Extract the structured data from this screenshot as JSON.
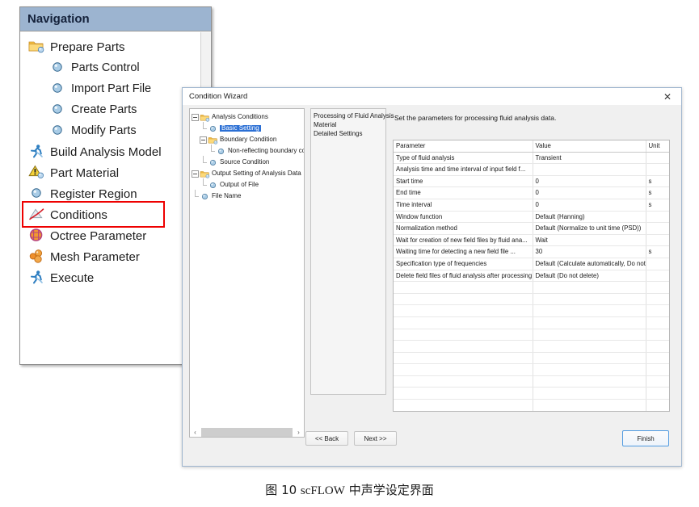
{
  "navigation": {
    "header": "Navigation",
    "items": [
      {
        "label": "Prepare Parts",
        "icon": "folder-icon",
        "level": 1
      },
      {
        "label": "Parts Control",
        "icon": "sphere-node-icon",
        "level": 2
      },
      {
        "label": "Import Part File",
        "icon": "sphere-node-icon",
        "level": 2
      },
      {
        "label": "Create Parts",
        "icon": "sphere-node-icon",
        "level": 2
      },
      {
        "label": "Modify Parts",
        "icon": "sphere-node-icon",
        "level": 2
      },
      {
        "label": "Build Analysis Model",
        "icon": "runner-icon",
        "level": 1
      },
      {
        "label": "Part Material",
        "icon": "warning-triangle-icon",
        "level": 1
      },
      {
        "label": "Register Region",
        "icon": "sphere-node-icon",
        "level": 1
      },
      {
        "label": "Conditions",
        "icon": "conditions-icon",
        "level": 1
      },
      {
        "label": "Octree Parameter",
        "icon": "octree-icon",
        "level": 1
      },
      {
        "label": "Mesh Parameter",
        "icon": "mesh-spheres-icon",
        "level": 1
      },
      {
        "label": "Execute",
        "icon": "runner-icon",
        "level": 1
      }
    ],
    "highlight_color": "#ee0000",
    "highlighted_item": "Conditions"
  },
  "dialog": {
    "title": "Condition Wizard",
    "close_glyph": "✕",
    "tree": [
      {
        "label": "Analysis Conditions",
        "level": 0,
        "icon": "folder-icon",
        "expander": true,
        "selected": false
      },
      {
        "label": "Basic Setting",
        "level": 1,
        "icon": "sphere-node-icon",
        "expander": false,
        "selected": true
      },
      {
        "label": "Boundary Condition",
        "level": 1,
        "icon": "folder-icon",
        "expander": true,
        "selected": false
      },
      {
        "label": "Non-reflecting boundary co",
        "level": 2,
        "icon": "sphere-node-icon",
        "expander": false,
        "selected": false
      },
      {
        "label": "Source Condition",
        "level": 1,
        "icon": "sphere-node-icon",
        "expander": false,
        "selected": false
      },
      {
        "label": "Output Setting of Analysis Data",
        "level": 0,
        "icon": "folder-icon",
        "expander": true,
        "selected": false
      },
      {
        "label": "Output of File",
        "level": 1,
        "icon": "sphere-node-icon",
        "expander": false,
        "selected": false
      },
      {
        "label": "File Name",
        "level": 0,
        "icon": "sphere-node-icon",
        "expander": false,
        "selected": false
      }
    ],
    "mid_list": [
      "Processing of Fluid Analysis",
      "Material",
      "Detailed Settings"
    ],
    "description": "Set the parameters for processing fluid analysis data.",
    "table": {
      "columns": [
        "Parameter",
        "Value",
        "Unit"
      ],
      "rows": [
        {
          "indent": 0,
          "parameter": "Type of fluid analysis",
          "value": "Transient",
          "unit": ""
        },
        {
          "indent": 1,
          "parameter": "Analysis time and time interval of input field f...",
          "value": "",
          "unit": ""
        },
        {
          "indent": 2,
          "parameter": "Start time",
          "value": "0",
          "unit": "s"
        },
        {
          "indent": 2,
          "parameter": "End time",
          "value": "0",
          "unit": "s"
        },
        {
          "indent": 2,
          "parameter": "Time interval",
          "value": "0",
          "unit": "s"
        },
        {
          "indent": 1,
          "parameter": "Window function",
          "value": "Default (Hanning)",
          "unit": ""
        },
        {
          "indent": 1,
          "parameter": "Normalization method",
          "value": "Default (Normalize to unit time (PSD))",
          "unit": ""
        },
        {
          "indent": 1,
          "parameter": "Wait for creation of new field files by fluid ana...",
          "value": "Wait",
          "unit": ""
        },
        {
          "indent": 2,
          "parameter": "Waiting time for detecting a new field file ...",
          "value": "30",
          "unit": "s"
        },
        {
          "indent": 0,
          "parameter": "Specification type of frequencies",
          "value": "Default (Calculate automatically, Do not ...",
          "unit": ""
        },
        {
          "indent": 0,
          "parameter": "Delete field files of fluid analysis after processing",
          "value": "Default (Do not delete)",
          "unit": ""
        }
      ]
    },
    "buttons": {
      "back": "<< Back",
      "next": "Next >>",
      "finish": "Finish"
    },
    "scrollbar": {
      "left_arrow": "‹",
      "right_arrow": "›"
    }
  },
  "caption": {
    "prefix": "图 10 ",
    "product": "scFLOW",
    "suffix": " 中声学设定界面"
  }
}
